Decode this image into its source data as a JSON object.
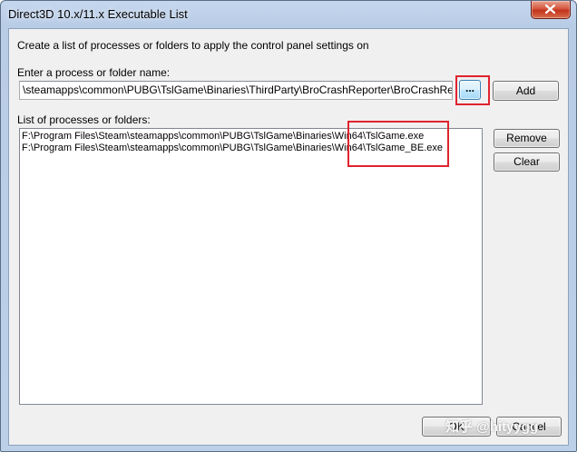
{
  "window": {
    "title": "Direct3D 10.x/11.x Executable List"
  },
  "instructions": "Create a list of processes or folders to apply the control panel settings on",
  "entry": {
    "label": "Enter a process or folder name:",
    "value": "\\steamapps\\common\\PUBG\\TslGame\\Binaries\\ThirdParty\\BroCrashReporter\\BroCrashReporter.exe",
    "browse_label": "...",
    "add_label": "Add"
  },
  "list": {
    "label": "List of processes or folders:",
    "items": [
      "F:\\Program Files\\Steam\\steamapps\\common\\PUBG\\TslGame\\Binaries\\Win64\\TslGame.exe",
      "F:\\Program Files\\Steam\\steamapps\\common\\PUBG\\TslGame\\Binaries\\Win64\\TslGame_BE.exe"
    ],
    "remove_label": "Remove",
    "clear_label": "Clear"
  },
  "footer": {
    "ok_label": "OK",
    "cancel_label": "Cancel"
  },
  "watermark": "知乎 @hityygg",
  "colors": {
    "highlight": "#e0232e",
    "titlebar": "#b9cce6",
    "close_button": "#c2331b",
    "client_background": "#f0f0f0"
  },
  "icons": {
    "close": "close-x-icon"
  }
}
